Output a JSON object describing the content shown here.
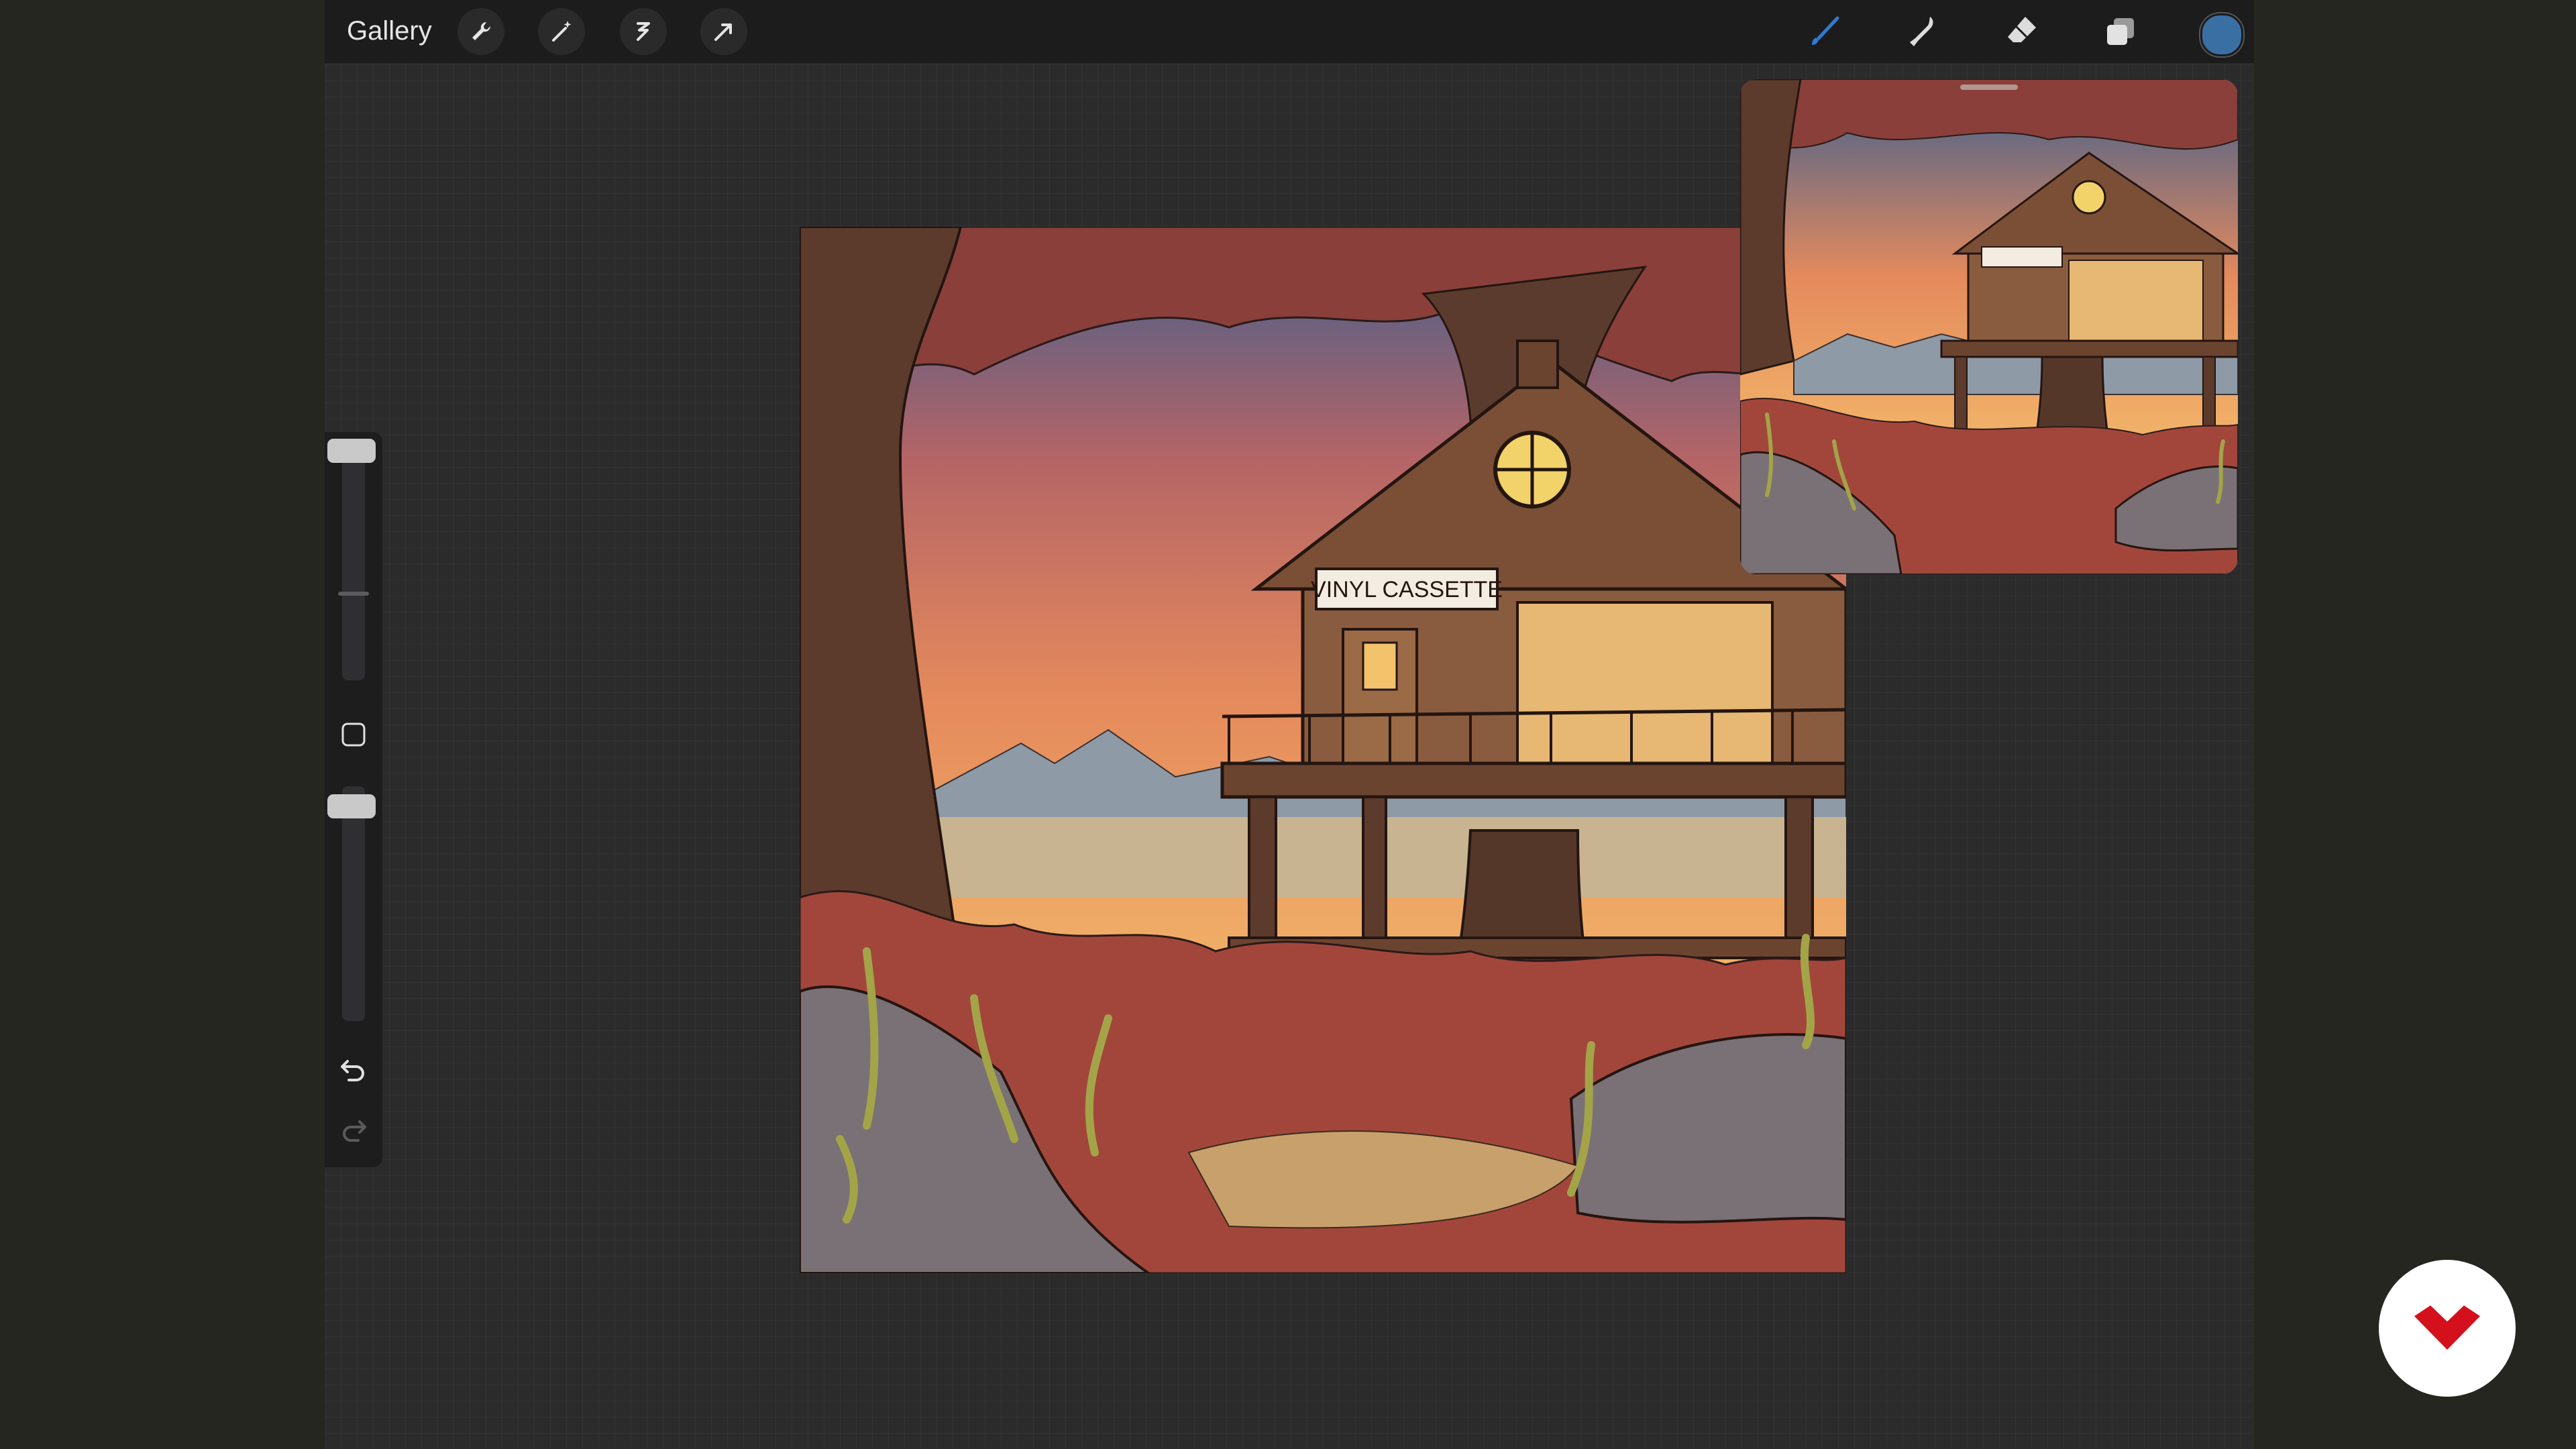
{
  "toolbar": {
    "gallery_label": "Gallery",
    "left_tools": [
      "wrench-icon",
      "magic-wand-icon",
      "selection-icon",
      "transform-arrow-icon"
    ],
    "right_tools": [
      "brush-icon",
      "smudge-icon",
      "eraser-icon",
      "layers-icon"
    ],
    "active_tool": "brush",
    "current_color": "#3a6fa3"
  },
  "sidebar": {
    "controls": [
      "brush-size-slider",
      "modify-square-button",
      "opacity-slider",
      "undo-button",
      "redo-button"
    ]
  },
  "canvas": {
    "sign_text": "VINYL CASSETTE",
    "reference_title": ""
  },
  "colors": {
    "accent_brush": "#2f7ad1",
    "logo_red": "#d4101c",
    "sky_top": "#3e5f8f",
    "sky_bottom": "#f2b66a"
  }
}
